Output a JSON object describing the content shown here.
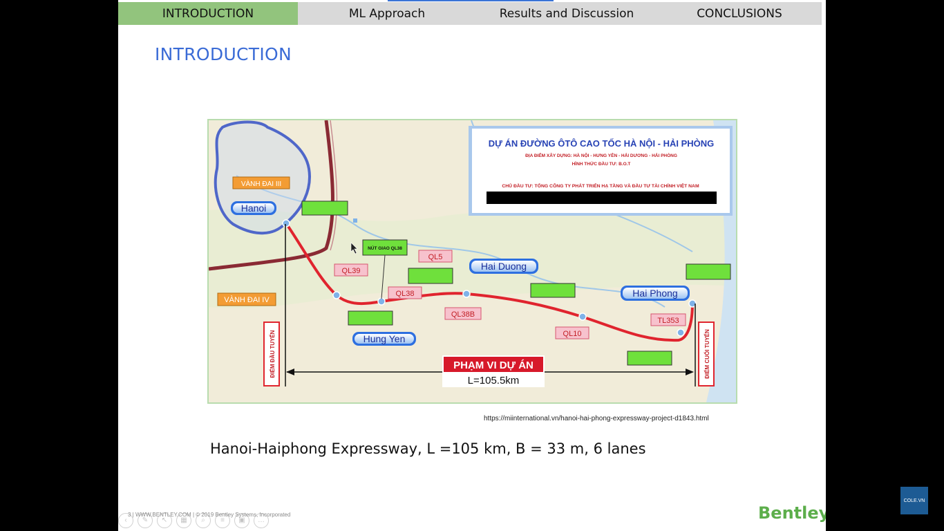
{
  "nav": {
    "tabs": [
      {
        "label": "INTRODUCTION",
        "active": true
      },
      {
        "label": "ML Approach",
        "active": false
      },
      {
        "label": "Results and Discussion",
        "active": false
      },
      {
        "label": "CONCLUSIONS",
        "active": false
      }
    ]
  },
  "slide": {
    "title": "INTRODUCTION",
    "caption": "Hanoi-Haiphong Expressway, L =105 km, B = 33 m, 6 lanes",
    "source_url": "https://miinternational.vn/hanoi-hai-phong-expressway-project-d1843.html",
    "footer": "3  |  WWW.BENTLEY.COM  |  © 2019 Bentley Systems, Incorporated",
    "logo": "Bentley"
  },
  "map": {
    "project_title": "DỰ ÁN ĐƯỜNG ÔTÔ CAO TỐC HÀ NỘI - HẢI PHÒNG",
    "project_location": "ĐỊA ĐIỂM XÂY DỰNG: HÀ NỘI - HƯNG YÊN - HẢI DƯƠNG - HẢI PHÒNG",
    "project_investment": "HÌNH THỨC ĐẦU TƯ: B.O.T",
    "project_owner": "CHỦ ĐẦU TƯ: TỔNG CÔNG TY PHÁT TRIỂN HẠ TẦNG VÀ ĐẦU TƯ TÀI CHÍNH VIỆT NAM",
    "cities": {
      "hanoi": "Hanoi",
      "hung_yen": "Hung Yen",
      "hai_duong": "Hai Duong",
      "hai_phong": "Hai Phong"
    },
    "ring_roads": {
      "ring3": "VÀNH ĐAI III",
      "ring4": "VÀNH ĐAI IV"
    },
    "roads": {
      "ql39": "QL39",
      "ql38": "QL38",
      "ql5": "QL5",
      "ql38b": "QL38B",
      "ql10": "QL10",
      "tl353": "TL353"
    },
    "junction_ql38": "NÚT GIAO QL38",
    "scope_title": "PHẠM VI DỰ ÁN",
    "scope_length": "L=105.5km",
    "start_point": "ĐIỂM ĐẦU TUYẾN",
    "end_point": "ĐIỂM CUỐI TUYẾN"
  },
  "overlay": {
    "badge": "COLE.VN"
  },
  "colors": {
    "nav_active": "#92c47d",
    "nav_bg": "#d9d9d9",
    "title": "#3a6bd6",
    "route": "#e0242e",
    "logo": "#5cae4b"
  }
}
